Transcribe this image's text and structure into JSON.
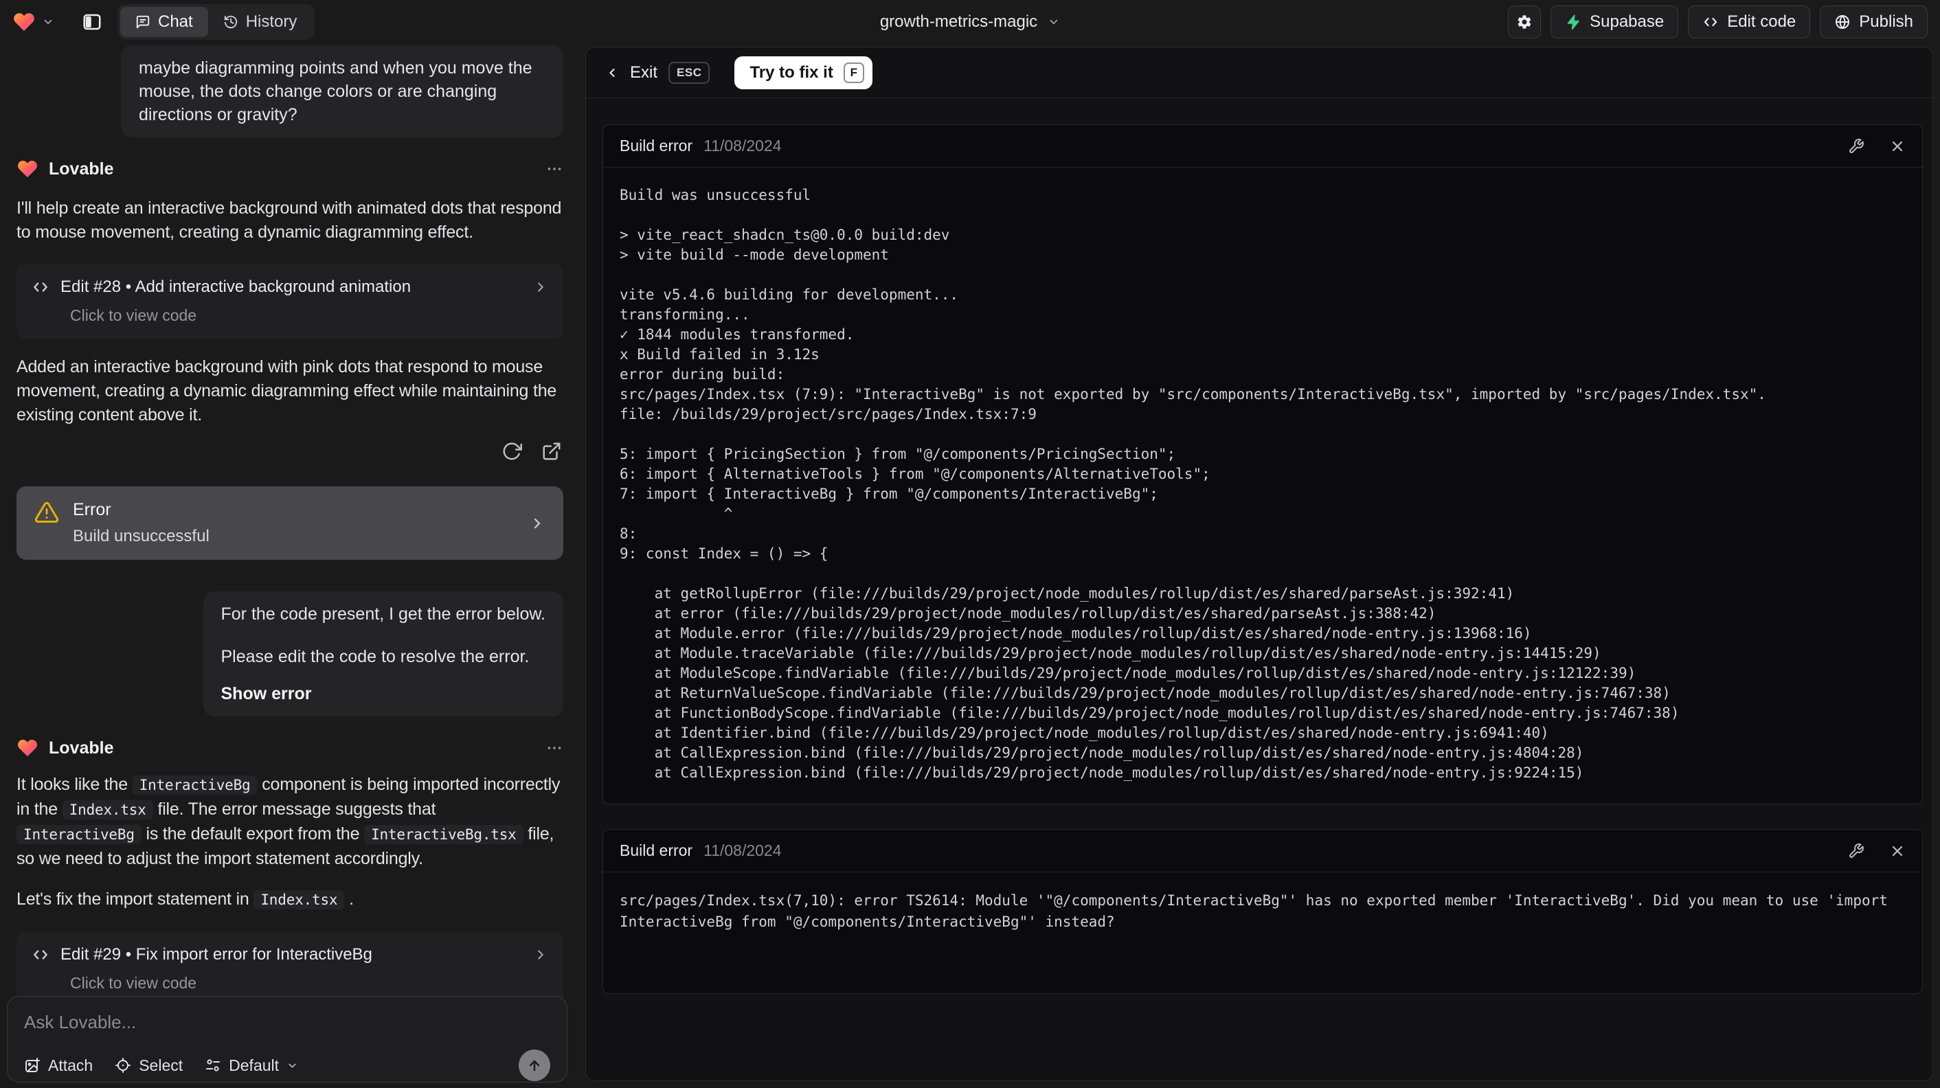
{
  "topbar": {
    "tabs": {
      "chat": "Chat",
      "history": "History"
    },
    "project_name": "growth-metrics-magic",
    "actions": {
      "supabase": "Supabase",
      "edit_code": "Edit code",
      "publish": "Publish"
    }
  },
  "chat": {
    "assistant_name": "Lovable",
    "user_message_1": "maybe diagramming points and when you move the mouse, the dots change colors or are changing directions or gravity?",
    "assistant_intro": "I'll help create an interactive background with animated dots that respond to mouse movement, creating a dynamic diagramming effect.",
    "edit_card_1": {
      "title": "Edit #28 • Add interactive background animation",
      "subtitle": "Click to view code"
    },
    "assistant_summary": "Added an interactive background with pink dots that respond to mouse movement, creating a dynamic diagramming effect while maintaining the existing content above it.",
    "error_card": {
      "title": "Error",
      "subtitle": "Build unsuccessful"
    },
    "user_message_2": {
      "line1": "For the code present, I get the error below.",
      "line2": "Please edit the code to resolve the error.",
      "action": "Show error"
    },
    "assistant_fix_segments": [
      {
        "text": "It looks like the "
      },
      {
        "text": "InteractiveBg",
        "code": true
      },
      {
        "text": " component is being imported incorrectly in the "
      },
      {
        "text": "Index.tsx",
        "code": true
      },
      {
        "text": " file. The error message suggests that "
      },
      {
        "text": "InteractiveBg",
        "code": true
      },
      {
        "text": " is the default export from the "
      },
      {
        "text": "InteractiveBg.tsx",
        "code": true
      },
      {
        "text": " file, so we need to adjust the import statement accordingly."
      }
    ],
    "assistant_fix_line2_segments": [
      {
        "text": "Let's fix the import statement in "
      },
      {
        "text": "Index.tsx",
        "code": true
      },
      {
        "text": " ."
      }
    ],
    "edit_card_2": {
      "title": "Edit #29 • Fix import error for InteractiveBg",
      "subtitle": "Click to view code"
    },
    "input": {
      "placeholder": "Ask Lovable...",
      "attach": "Attach",
      "select": "Select",
      "mode": "Default"
    }
  },
  "error_panel": {
    "exit_label": "Exit",
    "esc_key": "ESC",
    "fix_label": "Try to fix it",
    "fix_key": "F",
    "cards": [
      {
        "title": "Build error",
        "date": "11/08/2024",
        "log": "Build was unsuccessful\n\n> vite_react_shadcn_ts@0.0.0 build:dev\n> vite build --mode development\n\nvite v5.4.6 building for development...\ntransforming...\n✓ 1844 modules transformed.\nx Build failed in 3.12s\nerror during build:\nsrc/pages/Index.tsx (7:9): \"InteractiveBg\" is not exported by \"src/components/InteractiveBg.tsx\", imported by \"src/pages/Index.tsx\".\nfile: /builds/29/project/src/pages/Index.tsx:7:9\n\n5: import { PricingSection } from \"@/components/PricingSection\";\n6: import { AlternativeTools } from \"@/components/AlternativeTools\";\n7: import { InteractiveBg } from \"@/components/InteractiveBg\";\n            ^\n8: \n9: const Index = () => {\n\n    at getRollupError (file:///builds/29/project/node_modules/rollup/dist/es/shared/parseAst.js:392:41)\n    at error (file:///builds/29/project/node_modules/rollup/dist/es/shared/parseAst.js:388:42)\n    at Module.error (file:///builds/29/project/node_modules/rollup/dist/es/shared/node-entry.js:13968:16)\n    at Module.traceVariable (file:///builds/29/project/node_modules/rollup/dist/es/shared/node-entry.js:14415:29)\n    at ModuleScope.findVariable (file:///builds/29/project/node_modules/rollup/dist/es/shared/node-entry.js:12122:39)\n    at ReturnValueScope.findVariable (file:///builds/29/project/node_modules/rollup/dist/es/shared/node-entry.js:7467:38)\n    at FunctionBodyScope.findVariable (file:///builds/29/project/node_modules/rollup/dist/es/shared/node-entry.js:7467:38)\n    at Identifier.bind (file:///builds/29/project/node_modules/rollup/dist/es/shared/node-entry.js:6941:40)\n    at CallExpression.bind (file:///builds/29/project/node_modules/rollup/dist/es/shared/node-entry.js:4804:28)\n    at CallExpression.bind (file:///builds/29/project/node_modules/rollup/dist/es/shared/node-entry.js:9224:15)"
      },
      {
        "title": "Build error",
        "date": "11/08/2024",
        "log": "src/pages/Index.tsx(7,10): error TS2614: Module '\"@/components/InteractiveBg\"' has no exported member 'InteractiveBg'. Did you mean to use 'import InteractiveBg from \"@/components/InteractiveBg\"' instead?"
      }
    ]
  },
  "colors": {
    "supabase_green": "#3ecf8e",
    "warning_amber": "#e7b008",
    "logo_gradient": [
      "#ffa63d",
      "#ff5a60",
      "#d94fa6"
    ]
  }
}
